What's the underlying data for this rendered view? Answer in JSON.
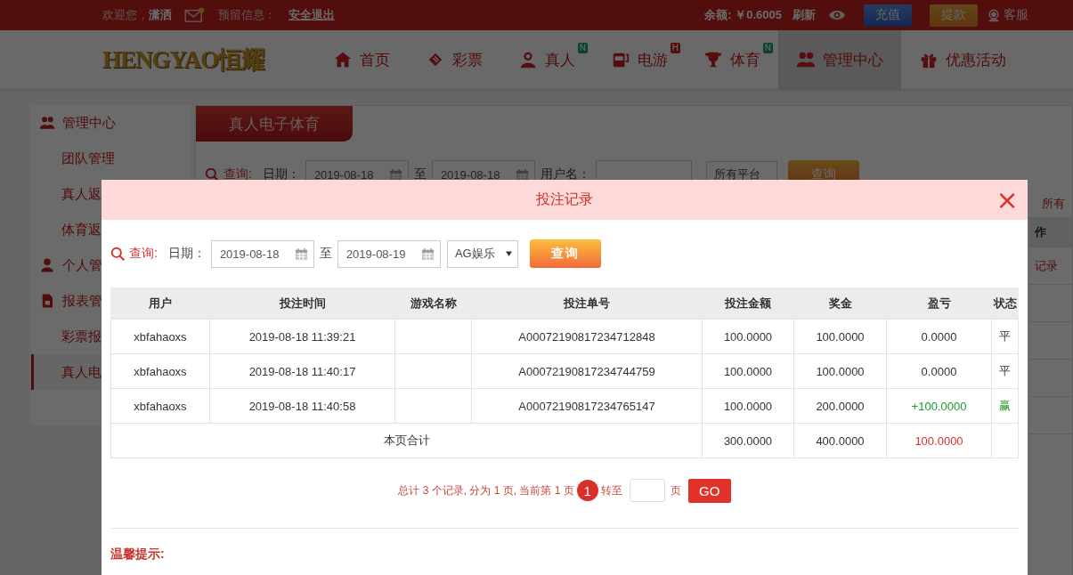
{
  "topbar": {
    "welcome": "欢迎您，",
    "username": "潇洒",
    "reserved_label": "预留信息：",
    "logout": "安全退出",
    "balance": "余额: ￥0.6005",
    "refresh": "刷新",
    "deposit": "充值",
    "withdraw": "提款",
    "service": "客服"
  },
  "logo": "HENGYAO恒耀",
  "nav": [
    {
      "label": "首页",
      "selected": false
    },
    {
      "label": "彩票",
      "selected": false
    },
    {
      "label": "真人",
      "selected": false,
      "badge": {
        "text": "N",
        "kind": "new"
      }
    },
    {
      "label": "电游",
      "selected": false,
      "badge": {
        "text": "H",
        "kind": "hot"
      }
    },
    {
      "label": "体育",
      "selected": false,
      "badge": {
        "text": "N",
        "kind": "new"
      }
    },
    {
      "label": "管理中心",
      "selected": true
    },
    {
      "label": "优惠活动",
      "selected": false
    }
  ],
  "sidebar": [
    {
      "kind": "header",
      "label": "管理中心",
      "selected": false
    },
    {
      "kind": "item",
      "label": "团队管理",
      "selected": false
    },
    {
      "kind": "item",
      "label": "真人返",
      "selected": false
    },
    {
      "kind": "item",
      "label": "体育返",
      "selected": false
    },
    {
      "kind": "header",
      "label": "个人管",
      "selected": false
    },
    {
      "kind": "header",
      "label": "报表管",
      "selected": false
    },
    {
      "kind": "item",
      "label": "彩票报",
      "selected": false
    },
    {
      "kind": "item",
      "label": "真人电",
      "selected": true
    }
  ],
  "main": {
    "tab": "真人电子体育",
    "filter": {
      "query": "查询:",
      "date_label": "日期：",
      "date_from": "2019-08-18",
      "to": "至",
      "date_to": "2019-08-18",
      "user_label": "用户名：",
      "platform": "所有平台",
      "button": "查询"
    },
    "platform_info": "所有",
    "column_header": "作",
    "row_link": "记录"
  },
  "modal": {
    "title": "投注记录",
    "close": "×",
    "filter": {
      "query": "查询:",
      "date_label": "日期：",
      "date_from": "2019-08-18",
      "to": "至",
      "date_to": "2019-08-19",
      "platform": "AG娱乐",
      "button": "查询"
    },
    "table": {
      "columns": [
        "用户",
        "投注时间",
        "游戏名称",
        "投注单号",
        "投注金额",
        "奖金",
        "盈亏",
        "状态"
      ],
      "rows": [
        {
          "kind": "draw",
          "cells": [
            "xbfahaoxs",
            "2019-08-18 11:39:21",
            "",
            "A00072190817234712848",
            "100.0000",
            "100.0000",
            "0.0000",
            "平"
          ]
        },
        {
          "kind": "draw",
          "cells": [
            "xbfahaoxs",
            "2019-08-18 11:40:17",
            "",
            "A00072190817234744759",
            "100.0000",
            "100.0000",
            "0.0000",
            "平"
          ]
        },
        {
          "kind": "win",
          "cells": [
            "xbfahaoxs",
            "2019-08-18 11:40:58",
            "",
            "A00072190817234765147",
            "100.0000",
            "200.0000",
            "+100.0000",
            "赢"
          ]
        }
      ],
      "total": {
        "label": "本页合计",
        "bet": "300.0000",
        "bonus": "400.0000",
        "profit": "100.0000"
      }
    },
    "pagination": {
      "summary": "总计 3 个记录, 分为 1 页, 当前第 1 页",
      "pages": [
        {
          "label": "1",
          "selected": true
        }
      ],
      "goto": "转至",
      "page_unit": "页",
      "go": "GO"
    },
    "tips_title": "温馨提示:"
  }
}
